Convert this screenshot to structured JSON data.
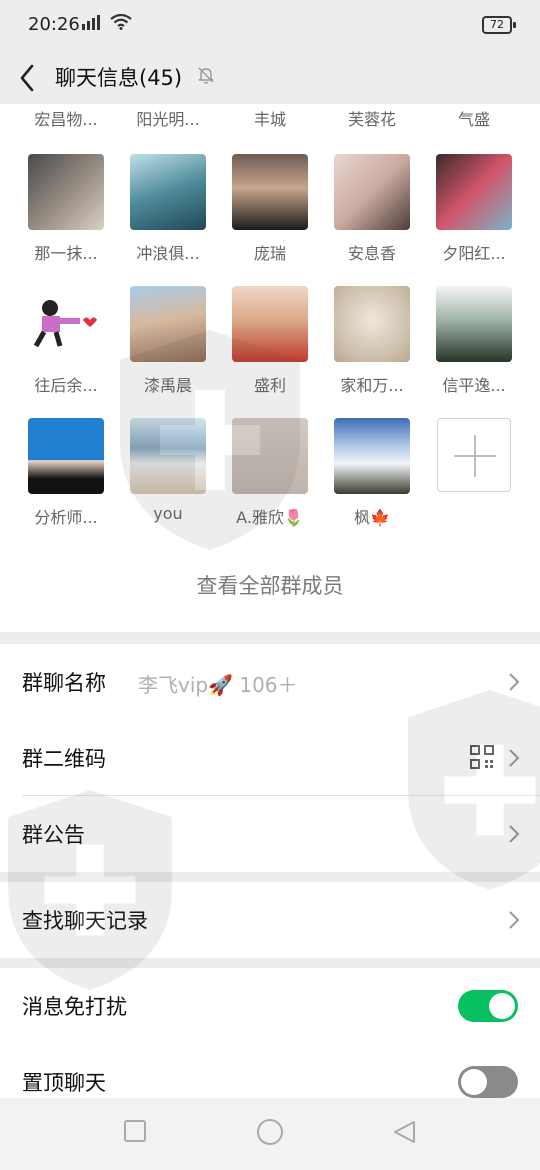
{
  "status_bar": {
    "time": "20:26",
    "battery": "72"
  },
  "header": {
    "title": "聊天信息(45)"
  },
  "members": {
    "clipped_row": [
      "宏昌物...",
      "阳光明...",
      "丰城",
      "芙蓉花",
      "气盛"
    ],
    "rows": [
      [
        {
          "name": "那一抹..."
        },
        {
          "name": "冲浪俱..."
        },
        {
          "name": "庞瑞"
        },
        {
          "name": "安息香"
        },
        {
          "name": "夕阳红..."
        }
      ],
      [
        {
          "name": "往后余..."
        },
        {
          "name": "漆禹晨"
        },
        {
          "name": "盛利"
        },
        {
          "name": "家和万..."
        },
        {
          "name": "信平逸..."
        }
      ],
      [
        {
          "name": "分析师..."
        },
        {
          "name": "you"
        },
        {
          "name": "A.雅欣🌷"
        },
        {
          "name": "枫🍁"
        }
      ]
    ],
    "view_all": "查看全部群成员"
  },
  "settings": {
    "group_name": {
      "label": "群聊名称",
      "value": "李飞vip🚀 106＋"
    },
    "qr_code": {
      "label": "群二维码"
    },
    "announcement": {
      "label": "群公告"
    },
    "search_history": {
      "label": "查找聊天记录"
    },
    "mute": {
      "label": "消息免打扰",
      "enabled": true
    },
    "pin": {
      "label": "置顶聊天",
      "enabled": false
    }
  },
  "colors": {
    "accent": "#07c160",
    "background": "#ededed"
  }
}
